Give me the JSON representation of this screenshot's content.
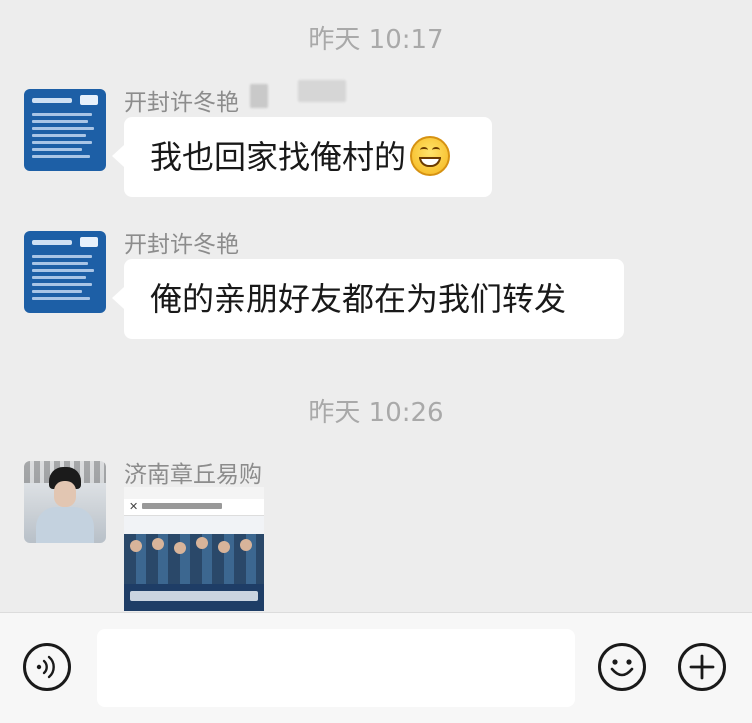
{
  "timestamps": [
    "昨天 10:17",
    "昨天 10:26"
  ],
  "messages": [
    {
      "sender": "开封许冬艳",
      "text": "我也回家找俺村的",
      "has_emoji": true,
      "emoji_name": "grin-emoji"
    },
    {
      "sender": "开封许冬艳",
      "text": "俺的亲朋好友都在为我们转发"
    },
    {
      "sender": "济南章丘易购",
      "card": "share-card"
    }
  ],
  "icons": {
    "voice": "voice-icon",
    "emoji": "emoji-icon",
    "plus": "plus-icon"
  }
}
